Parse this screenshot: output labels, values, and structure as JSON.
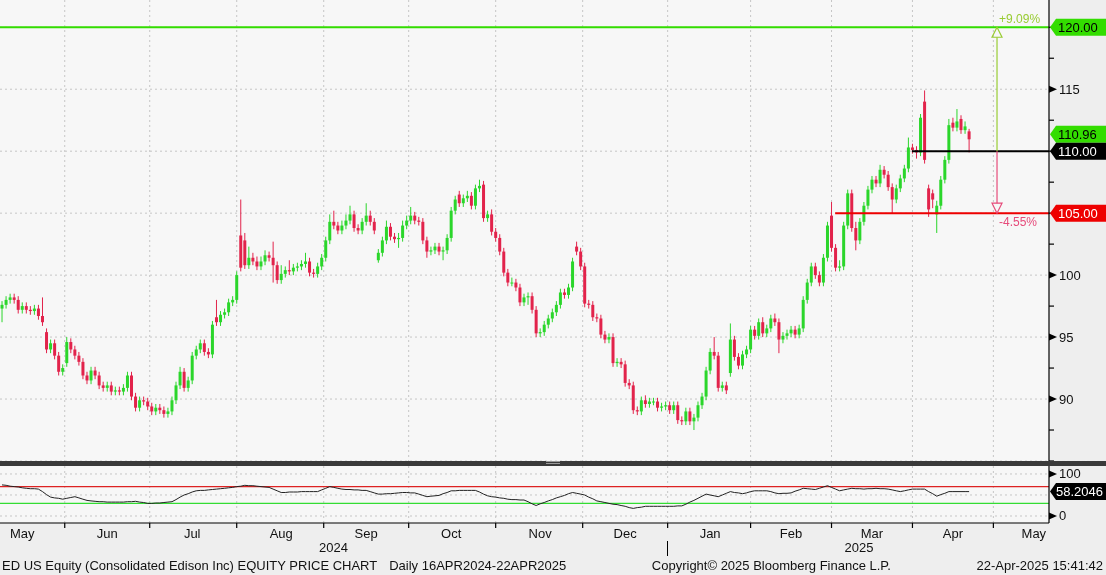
{
  "price_panel": {
    "chart_data": {
      "type": "candlestick",
      "grid": true,
      "ylim": [
        85,
        122.2
      ],
      "yticks": [
        90,
        95,
        100,
        115
      ],
      "ohlc": [
        [
          97.3,
          97.9,
          96.2,
          97.6
        ],
        [
          97.6,
          98.3,
          97.3,
          98.0
        ],
        [
          98.0,
          98.5,
          97.7,
          98.2
        ],
        [
          98.2,
          98.5,
          97.7,
          98.0
        ],
        [
          98.0,
          98.3,
          96.9,
          97.2
        ],
        [
          97.2,
          97.8,
          96.9,
          97.5
        ],
        [
          97.5,
          97.8,
          96.9,
          97.2
        ],
        [
          97.2,
          97.5,
          96.8,
          97.1
        ],
        [
          97.1,
          97.6,
          96.8,
          97.3
        ],
        [
          97.3,
          97.6,
          96.4,
          96.7
        ],
        [
          96.7,
          98.2,
          95.9,
          96.2
        ],
        [
          95.4,
          95.7,
          93.7,
          94.0
        ],
        [
          94.0,
          94.8,
          93.7,
          94.5
        ],
        [
          94.5,
          94.8,
          93.2,
          93.5
        ],
        [
          93.5,
          93.8,
          91.9,
          92.2
        ],
        [
          92.2,
          92.8,
          91.9,
          92.5
        ],
        [
          92.9,
          95.0,
          92.6,
          94.6
        ],
        [
          94.6,
          94.9,
          93.7,
          94.0
        ],
        [
          94.0,
          94.3,
          93.2,
          93.5
        ],
        [
          93.5,
          93.8,
          92.7,
          93.0
        ],
        [
          93.0,
          93.3,
          91.6,
          91.9
        ],
        [
          91.9,
          92.2,
          91.2,
          91.5
        ],
        [
          91.5,
          92.6,
          91.2,
          92.3
        ],
        [
          92.3,
          92.6,
          91.6,
          91.9
        ],
        [
          91.9,
          92.2,
          90.8,
          91.1
        ],
        [
          91.1,
          91.4,
          90.6,
          90.9
        ],
        [
          90.9,
          91.4,
          90.6,
          91.1
        ],
        [
          91.1,
          91.4,
          90.3,
          90.6
        ],
        [
          90.6,
          91.0,
          90.3,
          90.7
        ],
        [
          90.7,
          91.0,
          90.3,
          90.6
        ],
        [
          90.6,
          91.2,
          90.3,
          90.9
        ],
        [
          90.9,
          92.2,
          90.6,
          91.9
        ],
        [
          91.9,
          92.2,
          89.9,
          90.2
        ],
        [
          90.2,
          90.5,
          89.0,
          89.3
        ],
        [
          89.3,
          90.2,
          89.0,
          89.9
        ],
        [
          89.9,
          90.2,
          89.5,
          89.8
        ],
        [
          89.8,
          90.1,
          89.1,
          89.4
        ],
        [
          89.4,
          89.7,
          88.7,
          89.0
        ],
        [
          89.0,
          89.6,
          88.7,
          89.3
        ],
        [
          89.3,
          89.6,
          88.8,
          89.1
        ],
        [
          89.1,
          89.4,
          88.5,
          88.8
        ],
        [
          88.8,
          89.3,
          88.5,
          89.0
        ],
        [
          89.0,
          90.2,
          88.7,
          89.9
        ],
        [
          89.9,
          91.4,
          89.6,
          91.1
        ],
        [
          91.1,
          92.6,
          90.8,
          92.2
        ],
        [
          92.2,
          92.5,
          90.6,
          90.9
        ],
        [
          90.9,
          91.8,
          90.6,
          91.5
        ],
        [
          91.5,
          93.8,
          91.2,
          93.5
        ],
        [
          93.5,
          94.3,
          93.2,
          94.0
        ],
        [
          94.0,
          94.8,
          93.7,
          94.5
        ],
        [
          94.5,
          94.8,
          93.5,
          93.8
        ],
        [
          93.8,
          94.1,
          93.3,
          93.6
        ],
        [
          93.6,
          96.3,
          93.3,
          96.0
        ],
        [
          96.6,
          98.0,
          95.9,
          96.2
        ],
        [
          96.2,
          97.1,
          95.9,
          96.8
        ],
        [
          96.8,
          97.3,
          96.5,
          97.0
        ],
        [
          97.0,
          98.1,
          96.7,
          97.8
        ],
        [
          97.8,
          98.3,
          97.5,
          98.0
        ],
        [
          98.0,
          100.3,
          97.7,
          100.0
        ],
        [
          103.2,
          106.1,
          100.3,
          100.6
        ],
        [
          102.8,
          103.4,
          100.5,
          100.8
        ],
        [
          100.8,
          102.3,
          100.5,
          101.4
        ],
        [
          101.4,
          101.8,
          100.8,
          101.1
        ],
        [
          101.1,
          101.5,
          100.4,
          100.7
        ],
        [
          100.7,
          101.5,
          100.4,
          101.1
        ],
        [
          101.1,
          102.0,
          100.8,
          101.6
        ],
        [
          101.6,
          101.9,
          101.1,
          101.4
        ],
        [
          101.4,
          102.7,
          99.4,
          100.8
        ],
        [
          100.8,
          101.1,
          99.3,
          99.6
        ],
        [
          99.6,
          100.8,
          99.3,
          100.1
        ],
        [
          100.1,
          100.7,
          99.8,
          100.4
        ],
        [
          100.4,
          101.2,
          100.0,
          100.3
        ],
        [
          100.3,
          100.9,
          100.0,
          100.6
        ],
        [
          100.6,
          101.0,
          100.3,
          100.7
        ],
        [
          100.7,
          101.2,
          100.4,
          100.9
        ],
        [
          100.9,
          101.8,
          100.6,
          101.1
        ],
        [
          101.1,
          101.4,
          99.9,
          100.2
        ],
        [
          100.2,
          100.5,
          99.8,
          100.1
        ],
        [
          100.1,
          101.0,
          99.8,
          100.7
        ],
        [
          100.7,
          101.7,
          100.4,
          101.4
        ],
        [
          101.4,
          103.1,
          101.1,
          102.8
        ],
        [
          102.8,
          104.9,
          102.5,
          104.3
        ],
        [
          104.3,
          105.2,
          103.7,
          104.0
        ],
        [
          104.0,
          104.3,
          103.3,
          103.6
        ],
        [
          103.6,
          104.4,
          103.3,
          104.0
        ],
        [
          104.0,
          104.9,
          103.7,
          104.4
        ],
        [
          104.4,
          105.6,
          104.1,
          104.9
        ],
        [
          104.9,
          105.2,
          103.5,
          103.8
        ],
        [
          103.8,
          104.1,
          103.3,
          103.6
        ],
        [
          103.6,
          104.6,
          103.3,
          104.3
        ],
        [
          104.3,
          105.8,
          104.0,
          104.8
        ],
        [
          104.8,
          105.2,
          104.0,
          104.3
        ],
        [
          104.3,
          104.6,
          103.3,
          103.6
        ],
        [
          101.2,
          102.1,
          101.0,
          101.8
        ],
        [
          101.8,
          103.1,
          101.5,
          102.8
        ],
        [
          102.8,
          104.4,
          102.5,
          103.9
        ],
        [
          103.9,
          104.2,
          102.8,
          103.1
        ],
        [
          103.1,
          103.4,
          102.6,
          102.9
        ],
        [
          102.9,
          103.4,
          102.2,
          103.0
        ],
        [
          103.0,
          104.4,
          102.7,
          104.0
        ],
        [
          104.0,
          104.8,
          103.7,
          104.4
        ],
        [
          104.4,
          105.5,
          104.1,
          104.8
        ],
        [
          104.8,
          105.1,
          104.1,
          104.4
        ],
        [
          104.4,
          104.7,
          104.0,
          104.3
        ],
        [
          104.3,
          104.6,
          102.5,
          102.8
        ],
        [
          102.8,
          103.1,
          101.4,
          101.9
        ],
        [
          101.9,
          102.3,
          101.6,
          102.0
        ],
        [
          102.0,
          102.6,
          101.7,
          102.3
        ],
        [
          102.3,
          102.6,
          101.6,
          101.9
        ],
        [
          101.9,
          102.3,
          101.2,
          102.0
        ],
        [
          102.0,
          103.3,
          101.7,
          103.0
        ],
        [
          103.0,
          105.5,
          102.7,
          105.2
        ],
        [
          105.2,
          106.4,
          104.9,
          106.1
        ],
        [
          106.5,
          106.8,
          105.5,
          105.8
        ],
        [
          105.8,
          106.5,
          105.5,
          106.2
        ],
        [
          106.2,
          106.8,
          105.9,
          106.4
        ],
        [
          106.4,
          106.7,
          105.3,
          105.6
        ],
        [
          105.6,
          107.3,
          105.3,
          107.0
        ],
        [
          107.0,
          107.7,
          106.7,
          107.2
        ],
        [
          107.3,
          107.6,
          104.3,
          104.6
        ],
        [
          104.6,
          105.2,
          104.3,
          104.9
        ],
        [
          104.9,
          105.3,
          103.2,
          103.5
        ],
        [
          103.5,
          103.8,
          102.7,
          103.0
        ],
        [
          103.0,
          103.3,
          101.6,
          101.9
        ],
        [
          101.9,
          102.2,
          99.9,
          100.2
        ],
        [
          100.2,
          100.5,
          99.1,
          99.4
        ],
        [
          99.4,
          99.8,
          99.1,
          99.4
        ],
        [
          99.4,
          99.7,
          98.7,
          99.0
        ],
        [
          99.0,
          99.3,
          97.5,
          97.8
        ],
        [
          97.8,
          98.5,
          97.5,
          98.2
        ],
        [
          98.2,
          98.6,
          97.6,
          98.3
        ],
        [
          98.3,
          98.6,
          96.9,
          97.2
        ],
        [
          97.2,
          97.5,
          95.0,
          95.3
        ],
        [
          95.3,
          95.7,
          95.0,
          95.4
        ],
        [
          95.4,
          96.3,
          95.1,
          96.0
        ],
        [
          96.0,
          96.8,
          95.7,
          96.5
        ],
        [
          96.5,
          97.3,
          96.2,
          97.0
        ],
        [
          97.0,
          97.9,
          96.7,
          97.6
        ],
        [
          97.6,
          98.9,
          97.3,
          98.6
        ],
        [
          98.6,
          98.9,
          98.1,
          98.4
        ],
        [
          98.4,
          99.3,
          98.1,
          99.0
        ],
        [
          99.0,
          101.4,
          98.7,
          101.1
        ],
        [
          102.3,
          102.7,
          101.6,
          101.9
        ],
        [
          101.9,
          102.2,
          100.4,
          100.7
        ],
        [
          100.7,
          101.0,
          97.4,
          97.7
        ],
        [
          97.7,
          98.0,
          97.3,
          97.6
        ],
        [
          97.6,
          97.9,
          96.3,
          96.6
        ],
        [
          96.6,
          96.9,
          96.2,
          96.5
        ],
        [
          96.5,
          96.8,
          94.9,
          95.2
        ],
        [
          95.2,
          95.5,
          94.5,
          94.8
        ],
        [
          94.8,
          95.3,
          94.5,
          95.0
        ],
        [
          95.0,
          95.3,
          92.6,
          92.9
        ],
        [
          92.9,
          93.3,
          92.6,
          93.0
        ],
        [
          93.0,
          93.3,
          92.5,
          92.8
        ],
        [
          92.8,
          93.1,
          91.0,
          91.3
        ],
        [
          91.3,
          91.6,
          90.8,
          91.1
        ],
        [
          91.1,
          91.4,
          88.8,
          89.1
        ],
        [
          89.1,
          89.4,
          88.7,
          89.0
        ],
        [
          89.0,
          90.2,
          88.7,
          89.9
        ],
        [
          89.9,
          90.3,
          89.3,
          89.6
        ],
        [
          89.6,
          90.1,
          89.3,
          89.8
        ],
        [
          89.8,
          90.1,
          89.5,
          89.8
        ],
        [
          89.8,
          90.1,
          89.0,
          89.3
        ],
        [
          89.3,
          89.7,
          89.0,
          89.4
        ],
        [
          89.4,
          89.8,
          89.1,
          89.5
        ],
        [
          89.5,
          89.8,
          88.8,
          89.1
        ],
        [
          89.1,
          89.8,
          88.8,
          89.5
        ],
        [
          89.5,
          89.8,
          88.0,
          88.3
        ],
        [
          88.3,
          88.6,
          87.9,
          88.2
        ],
        [
          88.2,
          89.3,
          87.9,
          89.0
        ],
        [
          89.0,
          89.3,
          87.9,
          88.2
        ],
        [
          88.2,
          88.8,
          87.5,
          88.5
        ],
        [
          88.5,
          89.8,
          88.2,
          89.5
        ],
        [
          89.5,
          90.5,
          89.2,
          90.2
        ],
        [
          90.2,
          92.6,
          89.9,
          92.3
        ],
        [
          92.3,
          94.1,
          92.0,
          93.8
        ],
        [
          93.8,
          95.0,
          93.2,
          93.5
        ],
        [
          93.5,
          93.8,
          90.6,
          90.9
        ],
        [
          90.9,
          91.4,
          90.6,
          91.1
        ],
        [
          91.1,
          91.4,
          90.4,
          90.7
        ],
        [
          92.1,
          96.1,
          91.8,
          94.8
        ],
        [
          94.8,
          95.1,
          93.1,
          93.4
        ],
        [
          93.4,
          93.7,
          92.4,
          92.7
        ],
        [
          92.7,
          93.9,
          92.4,
          93.6
        ],
        [
          93.6,
          94.3,
          93.3,
          94.0
        ],
        [
          94.0,
          95.9,
          93.7,
          95.6
        ],
        [
          95.6,
          95.9,
          94.8,
          95.1
        ],
        [
          95.1,
          96.5,
          94.8,
          96.2
        ],
        [
          96.2,
          96.6,
          95.0,
          95.3
        ],
        [
          95.3,
          96.0,
          95.0,
          95.7
        ],
        [
          95.7,
          96.8,
          95.4,
          96.5
        ],
        [
          96.5,
          96.9,
          95.9,
          96.2
        ],
        [
          96.2,
          96.5,
          93.7,
          94.8
        ],
        [
          94.8,
          95.4,
          94.5,
          95.1
        ],
        [
          95.1,
          95.6,
          94.8,
          95.3
        ],
        [
          95.3,
          95.9,
          95.0,
          95.6
        ],
        [
          95.6,
          95.9,
          94.9,
          95.2
        ],
        [
          95.2,
          96.0,
          94.9,
          95.7
        ],
        [
          95.7,
          98.3,
          95.4,
          98.0
        ],
        [
          98.0,
          99.7,
          97.7,
          99.4
        ],
        [
          99.4,
          101.0,
          99.1,
          100.7
        ],
        [
          100.7,
          101.0,
          99.7,
          100.0
        ],
        [
          100.0,
          100.3,
          99.1,
          99.4
        ],
        [
          99.4,
          101.7,
          99.1,
          101.4
        ],
        [
          101.4,
          104.3,
          101.1,
          104.0
        ],
        [
          104.8,
          105.9,
          101.9,
          102.2
        ],
        [
          102.2,
          102.5,
          100.3,
          100.6
        ],
        [
          100.6,
          101.2,
          100.3,
          100.7
        ],
        [
          100.7,
          104.3,
          100.4,
          104.0
        ],
        [
          104.0,
          106.9,
          103.7,
          106.6
        ],
        [
          106.6,
          106.9,
          103.5,
          103.8
        ],
        [
          103.8,
          104.3,
          102.0,
          102.8
        ],
        [
          102.8,
          104.6,
          102.5,
          104.3
        ],
        [
          104.3,
          105.9,
          104.0,
          105.6
        ],
        [
          105.6,
          107.2,
          105.3,
          106.9
        ],
        [
          106.9,
          108.0,
          106.6,
          107.7
        ],
        [
          107.7,
          108.0,
          107.1,
          107.4
        ],
        [
          107.4,
          108.9,
          107.1,
          108.5
        ],
        [
          108.5,
          108.8,
          107.8,
          108.1
        ],
        [
          108.1,
          108.4,
          106.8,
          107.1
        ],
        [
          107.1,
          107.4,
          105.0,
          106.1
        ],
        [
          106.1,
          107.3,
          105.8,
          107.0
        ],
        [
          107.0,
          108.1,
          106.7,
          107.8
        ],
        [
          107.8,
          108.9,
          107.5,
          108.6
        ],
        [
          108.6,
          111.1,
          108.3,
          110.3
        ],
        [
          110.3,
          110.6,
          109.8,
          110.1
        ],
        [
          110.1,
          110.4,
          109.4,
          109.9
        ],
        [
          109.9,
          113.0,
          109.6,
          112.7
        ],
        [
          114.0,
          114.9,
          109.0,
          109.3
        ],
        [
          107.0,
          107.3,
          104.7,
          105.3
        ],
        [
          106.6,
          106.9,
          105.4,
          106.1
        ],
        [
          104.9,
          106.0,
          103.4,
          105.6
        ],
        [
          105.6,
          108.0,
          105.3,
          107.7
        ],
        [
          107.7,
          109.6,
          107.4,
          109.3
        ],
        [
          109.3,
          112.6,
          109.0,
          112.1
        ],
        [
          112.3,
          112.7,
          111.6,
          111.9
        ],
        [
          111.9,
          113.4,
          111.6,
          112.4
        ],
        [
          112.6,
          112.9,
          111.4,
          111.7
        ],
        [
          111.7,
          112.4,
          111.4,
          112.0
        ],
        [
          111.6,
          111.8,
          109.9,
          110.96
        ],
        null,
        null,
        null,
        null,
        null,
        null,
        null,
        null,
        null,
        null,
        null,
        null,
        null,
        null,
        null,
        null,
        null,
        null,
        null
      ],
      "ref_lines": [
        {
          "axis": "y",
          "value": 120,
          "label": "120.00",
          "color": "#33dd00"
        },
        {
          "axis": "y",
          "value": 110,
          "label": "110.00",
          "color": "#000000"
        },
        {
          "axis": "y",
          "value": 105,
          "label": "105.00",
          "color": "#ee0000"
        }
      ],
      "annotations": [
        "+9.09%",
        "-4.55%"
      ]
    },
    "last_price": "110.96"
  },
  "rsi_panel": {
    "chart_data": {
      "type": "line",
      "grid": true,
      "ylim": [
        -16.7,
        119
      ],
      "yticks": [
        0,
        100
      ],
      "categories": [
        null,
        null,
        null,
        null,
        null,
        "May",
        null,
        null,
        null,
        null,
        null,
        null,
        null,
        null,
        null,
        null,
        null,
        null,
        null,
        null,
        null,
        null,
        null,
        null,
        null,
        null,
        "Jun",
        null,
        null,
        null,
        null,
        null,
        null,
        null,
        null,
        null,
        null,
        null,
        null,
        null,
        null,
        null,
        null,
        null,
        null,
        null,
        null,
        "Jul",
        null,
        null,
        null,
        null,
        null,
        null,
        null,
        null,
        null,
        null,
        null,
        null,
        null,
        null,
        null,
        null,
        null,
        null,
        null,
        null,
        null,
        "Aug",
        null,
        null,
        null,
        null,
        null,
        null,
        null,
        null,
        null,
        null,
        null,
        null,
        null,
        null,
        null,
        null,
        null,
        null,
        null,
        null,
        "Sep",
        null,
        null,
        null,
        null,
        null,
        null,
        null,
        null,
        null,
        null,
        null,
        null,
        null,
        null,
        null,
        null,
        null,
        null,
        null,
        null,
        "Oct",
        null,
        null,
        null,
        null,
        null,
        null,
        null,
        null,
        null,
        null,
        null,
        null,
        null,
        null,
        null,
        null,
        null,
        null,
        null,
        null,
        null,
        "Nov",
        null,
        null,
        null,
        null,
        null,
        null,
        null,
        null,
        null,
        null,
        null,
        null,
        null,
        null,
        null,
        null,
        null,
        null,
        null,
        null,
        "Dec",
        null,
        null,
        null,
        null,
        null,
        null,
        null,
        null,
        null,
        null,
        null,
        null,
        null,
        null,
        null,
        null,
        null,
        null,
        null,
        null,
        "Jan",
        null,
        null,
        null,
        null,
        null,
        null,
        null,
        null,
        null,
        null,
        null,
        null,
        null,
        null,
        null,
        null,
        null,
        null,
        null,
        "Feb",
        null,
        null,
        null,
        null,
        null,
        null,
        null,
        null,
        null,
        null,
        null,
        null,
        null,
        null,
        null,
        null,
        null,
        null,
        null,
        "Mar",
        null,
        null,
        null,
        null,
        null,
        null,
        null,
        null,
        null,
        null,
        null,
        null,
        null,
        null,
        null,
        null,
        null,
        null,
        null,
        "Apr",
        null,
        null,
        null,
        null,
        null,
        null,
        null,
        null,
        null,
        null,
        null,
        null,
        null,
        null,
        null,
        null,
        null,
        null,
        null,
        "May",
        null,
        null,
        null
      ],
      "series": [
        {
          "values": [
            74,
            73,
            71,
            70,
            69,
            67,
            66,
            65,
            65,
            64,
            58,
            51,
            45,
            43,
            42,
            40,
            42,
            44,
            46,
            43,
            40,
            37,
            36,
            35,
            34,
            34,
            33,
            33,
            33,
            33,
            33,
            34,
            34,
            35,
            33,
            32,
            30,
            30,
            31,
            31,
            32,
            33,
            34,
            39,
            45,
            50,
            53,
            57,
            60,
            61,
            61,
            62,
            63,
            64,
            65,
            66,
            67,
            68,
            70,
            71,
            73,
            72,
            72,
            71,
            70,
            69,
            68,
            64,
            60,
            56,
            56,
            57,
            57,
            57,
            58,
            58,
            58,
            58,
            58,
            62,
            66,
            70,
            68,
            66,
            64,
            63,
            63,
            62,
            62,
            61,
            61,
            58,
            55,
            52,
            52,
            53,
            53,
            54,
            55,
            56,
            56,
            55,
            55,
            52,
            49,
            46,
            47,
            48,
            49,
            53,
            56,
            60,
            60,
            61,
            61,
            61,
            61,
            61,
            57,
            52,
            48,
            46,
            45,
            43,
            42,
            40,
            39,
            39,
            38,
            38,
            34,
            29,
            25,
            29,
            32,
            36,
            39,
            43,
            46,
            49,
            53,
            56,
            54,
            52,
            50,
            45,
            41,
            36,
            34,
            32,
            30,
            28,
            27,
            25,
            23,
            20,
            18,
            20,
            21,
            23,
            23,
            23,
            23,
            23,
            23,
            23,
            23,
            24,
            24,
            28,
            33,
            37,
            42,
            47,
            52,
            50,
            48,
            46,
            50,
            54,
            58,
            56,
            55,
            53,
            55,
            58,
            60,
            60,
            60,
            60,
            58,
            55,
            53,
            54,
            54,
            55,
            59,
            62,
            66,
            65,
            64,
            63,
            66,
            69,
            72,
            68,
            64,
            60,
            62,
            64,
            66,
            65,
            65,
            64,
            65,
            65,
            66,
            65,
            65,
            64,
            62,
            60,
            58,
            60,
            62,
            64,
            64,
            64,
            64,
            58,
            53,
            47,
            51,
            54,
            58,
            58,
            58,
            58,
            58,
            58,
            null,
            null,
            null,
            null,
            null,
            null,
            null,
            null,
            null,
            null,
            null,
            null,
            null,
            null,
            null,
            null,
            null,
            null,
            null
          ]
        }
      ],
      "ref_lines": [
        {
          "axis": "y",
          "value": 70,
          "color": "#dd2222"
        },
        {
          "axis": "y",
          "value": 30,
          "color": "#33dd33"
        }
      ]
    },
    "last_value": "58.2046"
  },
  "years": [
    {
      "label": "2024"
    },
    {
      "label": "2025"
    }
  ],
  "footer": {
    "title": "ED US Equity (Consolidated Edison Inc) EQUITY PRICE CHART",
    "range": "Daily 16APR2024-22APR2025",
    "copyright": "Copyright© 2025 Bloomberg Finance L.P.",
    "timestamp": "22-Apr-2025 15:41:42"
  }
}
